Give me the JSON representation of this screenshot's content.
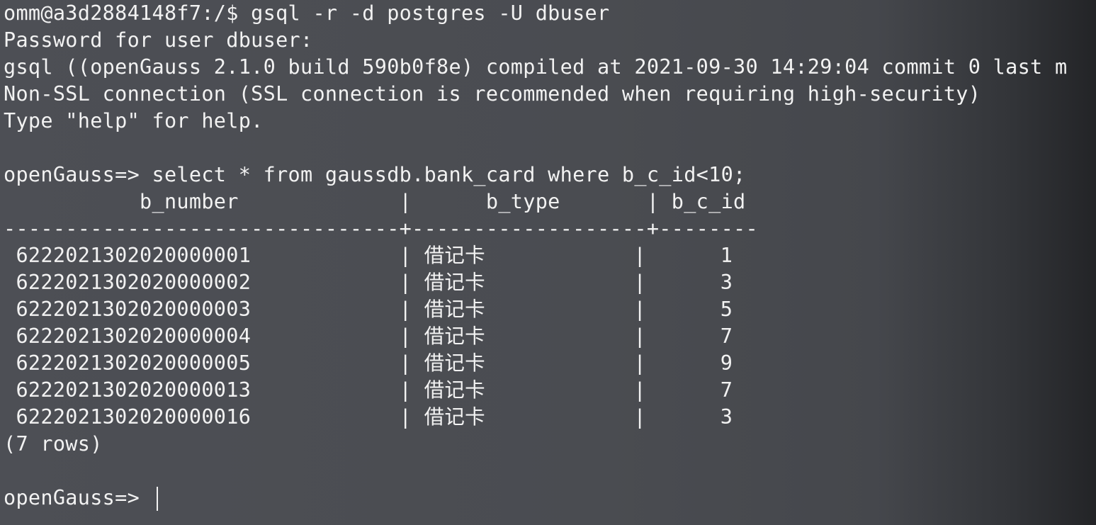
{
  "terminal": {
    "lines": [
      "omm@a3d2884148f7:/$ gsql -r -d postgres -U dbuser",
      "Password for user dbuser:",
      "gsql ((openGauss 2.1.0 build 590b0f8e) compiled at 2021-09-30 14:29:04 commit 0 last m",
      "Non-SSL connection (SSL connection is recommended when requiring high-security)",
      "Type \"help\" for help.",
      "",
      "openGauss=> select * from gaussdb.bank_card where b_c_id<10;"
    ],
    "table_header": "           b_number             |      b_type       | b_c_id ",
    "table_separator": "--------------------------------+-------------------+--------",
    "rows": [
      " 6222021302020000001            | 借记卡            |      1",
      " 6222021302020000002            | 借记卡            |      3",
      " 6222021302020000003            | 借记卡            |      5",
      " 6222021302020000004            | 借记卡            |      7",
      " 6222021302020000005            | 借记卡            |      9",
      " 6222021302020000013            | 借记卡            |      7",
      " 6222021302020000016            | 借记卡            |      3"
    ],
    "row_count": "(7 rows)",
    "blank": "",
    "prompt": "openGauss=> "
  },
  "colors": {
    "background": "#4a4c52",
    "text": "#f2f2f2"
  }
}
